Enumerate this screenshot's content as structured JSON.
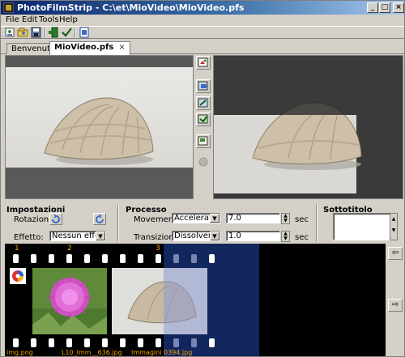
{
  "window": {
    "title": "PhotoFilmStrip - C:\\et\\MioVideo\\MioVideo.pfs",
    "controls": {
      "minimize": "_",
      "maximize": "□",
      "close": "×"
    }
  },
  "menu": [
    "File",
    "Edit",
    "Tools",
    "Help"
  ],
  "toolbar": [
    "new-project-icon",
    "open-project-icon",
    "save-project-icon",
    "import-pictures-icon",
    "render-check-icon",
    "render-film-icon"
  ],
  "tabs": [
    {
      "label": "Benvenuto"
    },
    {
      "label": "MioVideo.pfs",
      "close": "×"
    }
  ],
  "settings": {
    "title": "Impostazioni",
    "rotation_label": "Rotazione:",
    "effect_label": "Effetto:",
    "effect_value": "Nessun effetto"
  },
  "process": {
    "title": "Processo",
    "movement_label": "Movement:",
    "movement_value": "Accelerated",
    "movement_seconds": "7.0",
    "transition_label": "Transizione:",
    "transition_value": "Dissolvenza",
    "transition_seconds": "1.0",
    "unit": "sec"
  },
  "subtitle": {
    "title": "Sottotitolo",
    "value": ""
  },
  "filmstrip": {
    "numbers": [
      "1",
      "2",
      "3"
    ],
    "filenames": [
      "img.png",
      "L10_Imm__636.jpg",
      "Immagini 0394.jpg"
    ]
  },
  "colors": {
    "titlebar_start": "#0a246a",
    "titlebar_end": "#a6caf0",
    "film_number": "#f0a000",
    "selection": "#142a66"
  }
}
